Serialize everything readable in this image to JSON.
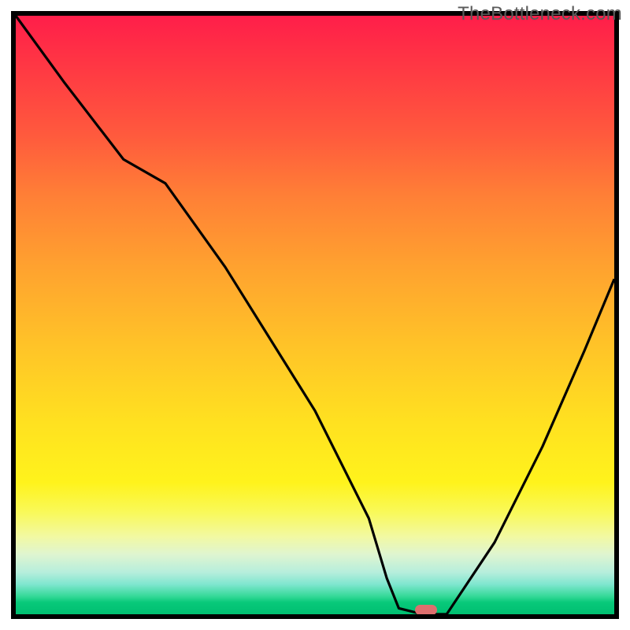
{
  "watermark": "TheBottleneck.com",
  "colors": {
    "gradient_top": "#ff1e4a",
    "gradient_mid": "#ffe120",
    "gradient_bottom": "#00bf71",
    "curve_stroke": "#000000",
    "marker_fill": "#de6f6e",
    "frame": "#000000"
  },
  "chart_data": {
    "type": "line",
    "title": "",
    "xlabel": "",
    "ylabel": "",
    "xlim": [
      0,
      100
    ],
    "ylim": [
      0,
      100
    ],
    "grid": false,
    "x": [
      0,
      8,
      18,
      25,
      35,
      50,
      59,
      62,
      64,
      68,
      72,
      80,
      88,
      95,
      100
    ],
    "values": [
      100,
      89,
      76,
      72,
      58,
      34,
      16,
      6,
      1,
      0,
      0,
      12,
      28,
      44,
      56
    ],
    "marker": {
      "x": 68.5,
      "y": 0
    },
    "legend": false
  }
}
